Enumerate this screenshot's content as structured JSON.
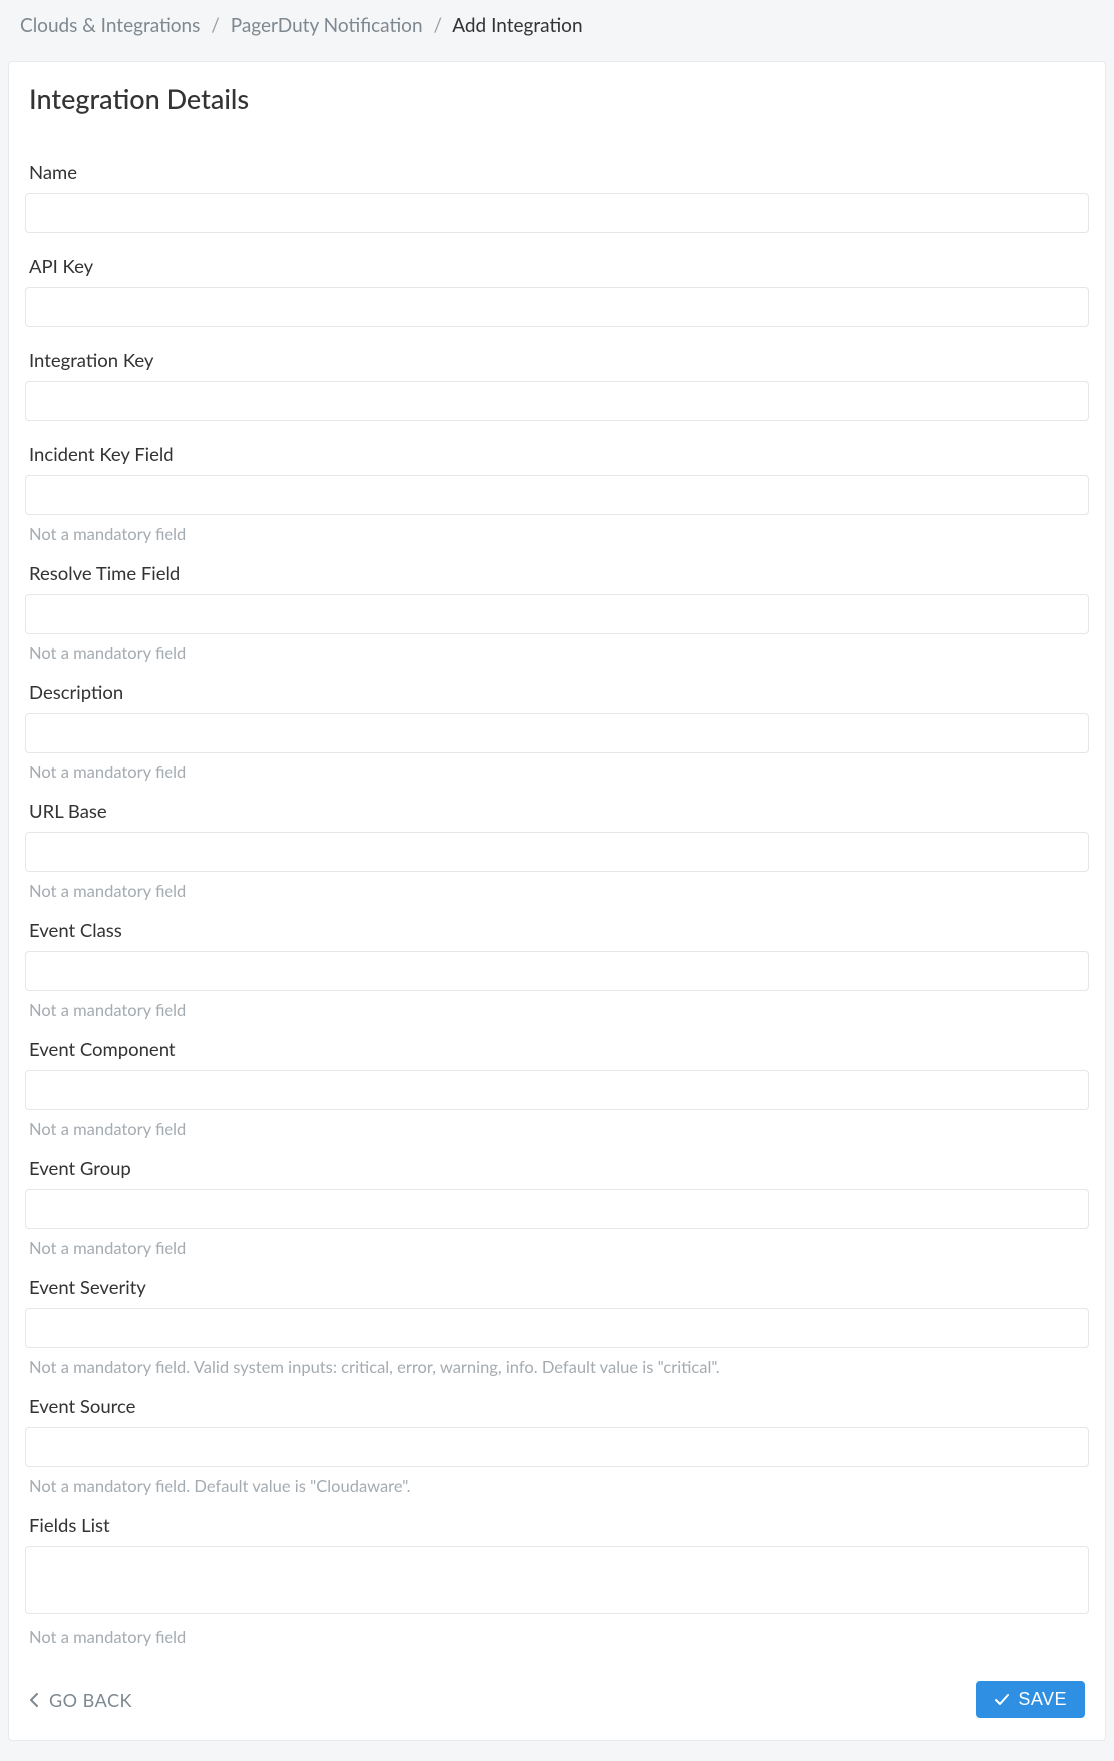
{
  "breadcrumb": {
    "item0": "Clouds & Integrations",
    "item1": "PagerDuty Notification",
    "current": "Add Integration"
  },
  "page": {
    "title": "Integration Details"
  },
  "fields": {
    "name": {
      "label": "Name",
      "value": "",
      "helper": ""
    },
    "api_key": {
      "label": "API Key",
      "value": "",
      "helper": ""
    },
    "integration_key": {
      "label": "Integration Key",
      "value": "",
      "helper": ""
    },
    "incident_key": {
      "label": "Incident Key Field",
      "value": "",
      "helper": "Not a mandatory field"
    },
    "resolve_time": {
      "label": "Resolve Time Field",
      "value": "",
      "helper": "Not a mandatory field"
    },
    "description": {
      "label": "Description",
      "value": "",
      "helper": "Not a mandatory field"
    },
    "url_base": {
      "label": "URL Base",
      "value": "",
      "helper": "Not a mandatory field"
    },
    "event_class": {
      "label": "Event Class",
      "value": "",
      "helper": "Not a mandatory field"
    },
    "event_component": {
      "label": "Event Component",
      "value": "",
      "helper": "Not a mandatory field"
    },
    "event_group": {
      "label": "Event Group",
      "value": "",
      "helper": "Not a mandatory field"
    },
    "event_severity": {
      "label": "Event Severity",
      "value": "",
      "helper": "Not a mandatory field. Valid system inputs: critical, error, warning, info. Default value is \"critical\"."
    },
    "event_source": {
      "label": "Event Source",
      "value": "",
      "helper": "Not a mandatory field. Default value is \"Cloudaware\"."
    },
    "fields_list": {
      "label": "Fields List",
      "value": "",
      "helper": "Not a mandatory field"
    }
  },
  "footer": {
    "go_back": "GO BACK",
    "save": "SAVE"
  }
}
